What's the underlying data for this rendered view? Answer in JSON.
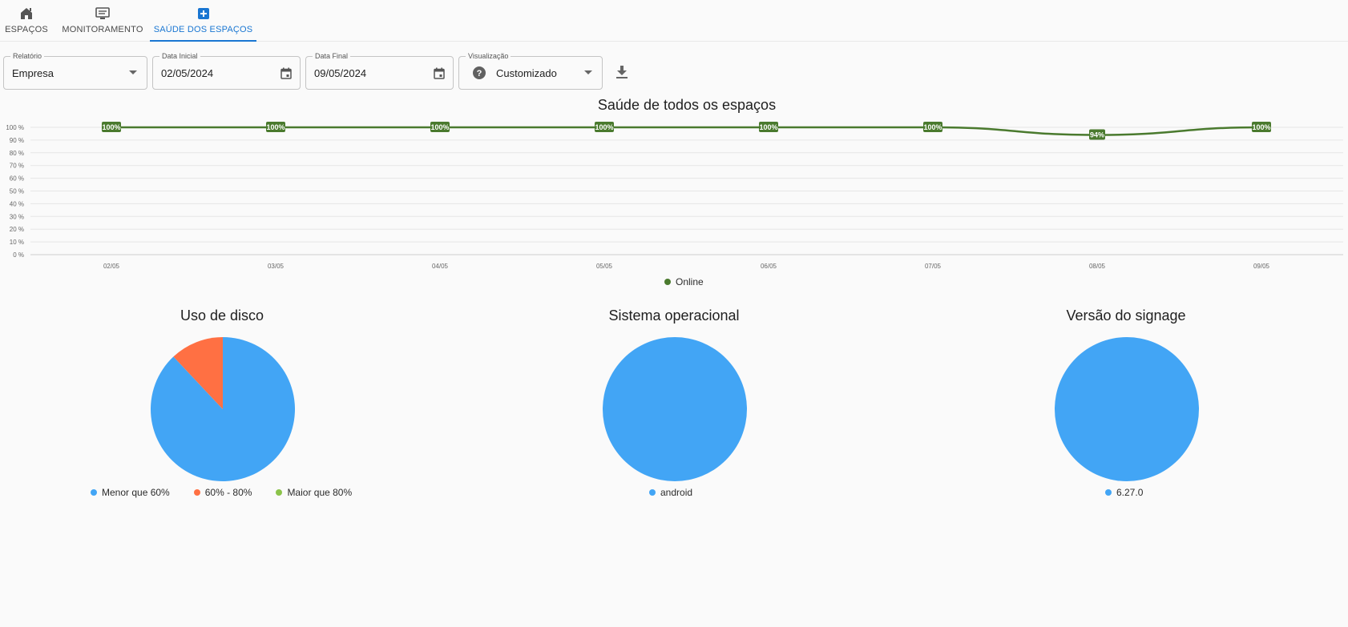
{
  "tabs": [
    {
      "label": "ESPAÇOS",
      "icon": "home-icon"
    },
    {
      "label": "MONITORAMENTO",
      "icon": "monitor-icon"
    },
    {
      "label": "SAÚDE DOS ESPAÇOS",
      "icon": "plus-box-icon"
    }
  ],
  "active_tab": 2,
  "filters": {
    "relatorio": {
      "legend": "Relatório",
      "value": "Empresa"
    },
    "data_inicial": {
      "legend": "Data Inicial",
      "value": "02/05/2024"
    },
    "data_final": {
      "legend": "Data Final",
      "value": "09/05/2024"
    },
    "visualizacao": {
      "legend": "Visualização",
      "value": "Customizado"
    }
  },
  "download_icon": "download-icon",
  "colors": {
    "primary": "#1976d2",
    "line": "#4a7a2e",
    "blue": "#42a5f5",
    "orange": "#ff7043",
    "green": "#8bc34a"
  },
  "chart_data": [
    {
      "type": "line",
      "title": "Saúde de todos os espaços",
      "categories": [
        "02/05",
        "03/05",
        "04/05",
        "05/05",
        "06/05",
        "07/05",
        "08/05",
        "09/05"
      ],
      "series": [
        {
          "name": "Online",
          "values": [
            100,
            100,
            100,
            100,
            100,
            100,
            94,
            100
          ],
          "color": "#4a7a2e"
        }
      ],
      "data_labels": [
        "100%",
        "100%",
        "100%",
        "100%",
        "100%",
        "100%",
        "94%",
        "100%"
      ],
      "ylim": [
        0,
        100
      ],
      "yticks": [
        "0 %",
        "10 %",
        "20 %",
        "30 %",
        "40 %",
        "50 %",
        "60 %",
        "70 %",
        "80 %",
        "90 %",
        "100 %"
      ],
      "grid": true,
      "legend_position": "bottom"
    },
    {
      "type": "pie",
      "title": "Uso de disco",
      "categories": [
        "Menor que 60%",
        "60% - 80%",
        "Maior que 80%"
      ],
      "values": [
        88,
        12,
        0
      ],
      "colors": [
        "#42a5f5",
        "#ff7043",
        "#8bc34a"
      ],
      "legend_position": "bottom"
    },
    {
      "type": "pie",
      "title": "Sistema operacional",
      "categories": [
        "android"
      ],
      "values": [
        100
      ],
      "colors": [
        "#42a5f5"
      ],
      "legend_position": "bottom"
    },
    {
      "type": "pie",
      "title": "Versão do signage",
      "categories": [
        "6.27.0"
      ],
      "values": [
        100
      ],
      "colors": [
        "#42a5f5"
      ],
      "legend_position": "bottom"
    }
  ]
}
